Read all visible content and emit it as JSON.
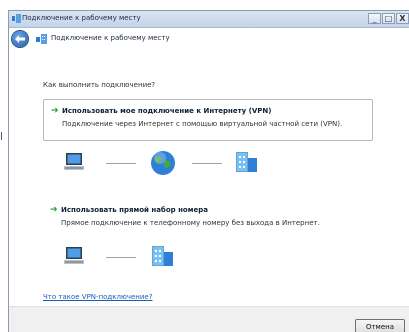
{
  "window": {
    "title": "Подключение к рабочему месту",
    "controls": [
      "minimize-icon",
      "maximize-icon",
      "close-icon"
    ]
  },
  "nav": {
    "back_icon": "back-arrow-icon",
    "page_title": "Подключение к рабочему месту"
  },
  "content": {
    "question": "Как выполнить подключение?",
    "options": [
      {
        "title": "Использовать мое подключение к Интернету (VPN)",
        "description": "Подключение через Интернет с помощью виртуальной частной сети (VPN).",
        "icons": [
          "computer-icon",
          "globe-icon",
          "office-building-icon"
        ]
      },
      {
        "title": "Использовать прямой набор номера",
        "description": "Прямое подключение к телефонному номеру без выхода в Интернет.",
        "icons": [
          "computer-icon",
          "office-building-icon"
        ]
      }
    ],
    "vpn_link": "Что такое VPN-подключение?"
  },
  "footer": {
    "cancel_label": "Отмена"
  },
  "colors": {
    "link": "#1a5fb4",
    "arrow": "#1a9c3a",
    "titlebar": "#c4d3e8"
  }
}
